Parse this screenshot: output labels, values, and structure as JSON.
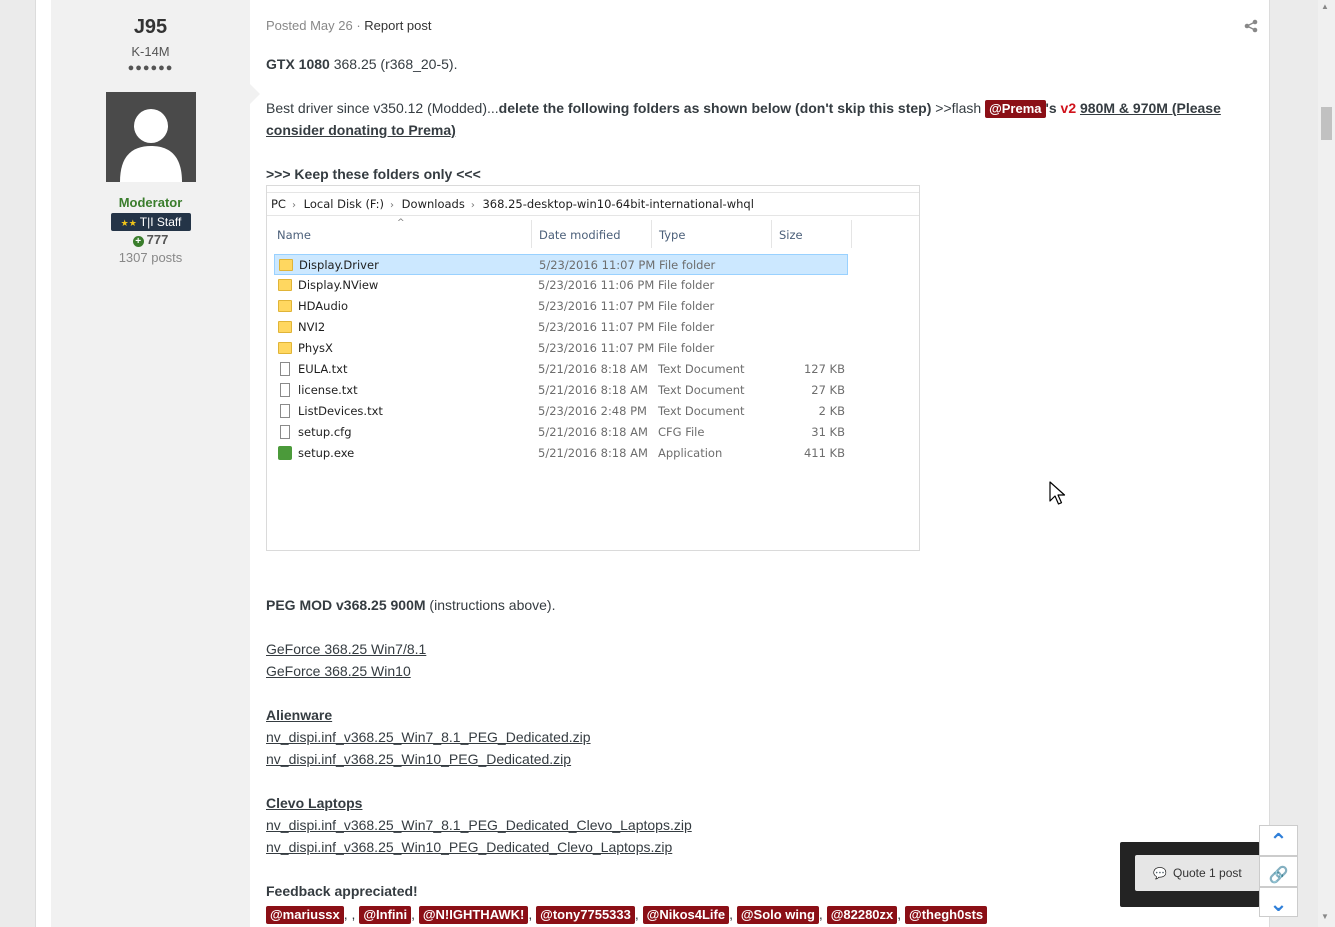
{
  "author": {
    "name": "J95",
    "title": "K-14M",
    "pips": "●●●●●●",
    "group": "Moderator",
    "badge": "T|I Staff",
    "badge_stars": "★★",
    "reputation": "777",
    "post_count": "1307 posts"
  },
  "post": {
    "posted": "Posted May 26",
    "separator": " · ",
    "report": "Report post",
    "line1_bold": "GTX 1080",
    "line1_rest": " 368.25 (r368_20-5).",
    "line2_start": "Best driver since v350.12 (Modded)...",
    "line2_bold": "delete the following folders as shown below (don't skip this step)",
    "line2_flash": "  >>flash ",
    "mention_prema": "@Prema",
    "apostrophe_s": "'s",
    "v2": "v2",
    "link_980": "980M & 970M (Please consider donating to Prema)",
    "keep_folders": ">>> Keep these folders only <<<",
    "peg_bold": "PEG MOD v368.25 900M",
    "peg_rest": " (instructions above).",
    "link_win7": "GeForce 368.25 Win7/8.1",
    "link_win10": "GeForce 368.25 Win10",
    "alienware": "Alienware",
    "alien_link1": "nv_dispi.inf_v368.25_Win7_8.1_PEG_Dedicated.zip",
    "alien_link2": "nv_dispi.inf_v368.25_Win10_PEG_Dedicated.zip",
    "clevo": "Clevo Laptops",
    "clevo_link1": "nv_dispi.inf_v368.25_Win7_8.1_PEG_Dedicated_Clevo_Laptops.zip",
    "clevo_link2": "nv_dispi.inf_v368.25_Win10_PEG_Dedicated_Clevo_Laptops.zip",
    "feedback": "Feedback appreciated!",
    "mentions": [
      "@mariussx",
      "@Infini",
      "@N!IGHTHAWK!",
      "@tony7755333",
      "@Nikos4Life",
      "@Solo wing",
      "@82280zx",
      "@thegh0sts"
    ]
  },
  "explorer": {
    "breadcrumb": [
      "PC",
      "Local Disk (F:)",
      "Downloads",
      "368.25-desktop-win10-64bit-international-whql"
    ],
    "columns": [
      "Name",
      "Date modified",
      "Type",
      "Size"
    ],
    "rows": [
      {
        "name": "Display.Driver",
        "date": "5/23/2016 11:07 PM",
        "type": "File folder",
        "size": "",
        "icon": "folder-icon",
        "selected": true
      },
      {
        "name": "Display.NView",
        "date": "5/23/2016 11:06 PM",
        "type": "File folder",
        "size": "",
        "icon": "folder-icon"
      },
      {
        "name": "HDAudio",
        "date": "5/23/2016 11:07 PM",
        "type": "File folder",
        "size": "",
        "icon": "folder-icon"
      },
      {
        "name": "NVI2",
        "date": "5/23/2016 11:07 PM",
        "type": "File folder",
        "size": "",
        "icon": "folder-icon"
      },
      {
        "name": "PhysX",
        "date": "5/23/2016 11:07 PM",
        "type": "File folder",
        "size": "",
        "icon": "folder-icon"
      },
      {
        "name": "EULA.txt",
        "date": "5/21/2016 8:18 AM",
        "type": "Text Document",
        "size": "127 KB",
        "icon": "text-file-icon"
      },
      {
        "name": "license.txt",
        "date": "5/21/2016 8:18 AM",
        "type": "Text Document",
        "size": "27 KB",
        "icon": "text-file-icon"
      },
      {
        "name": "ListDevices.txt",
        "date": "5/23/2016 2:48 PM",
        "type": "Text Document",
        "size": "2 KB",
        "icon": "text-file-icon"
      },
      {
        "name": "setup.cfg",
        "date": "5/21/2016 8:18 AM",
        "type": "CFG File",
        "size": "31 KB",
        "icon": "file-icon"
      },
      {
        "name": "setup.exe",
        "date": "5/21/2016 8:18 AM",
        "type": "Application",
        "size": "411 KB",
        "icon": "exe-icon"
      }
    ]
  },
  "quote_popup": {
    "label": "Quote 1 post"
  },
  "colors": {
    "mention_bg": "#8b0f16",
    "moderator_green": "#3a7d2c",
    "staff_badge": "#243447",
    "nav_blue": "#2f7fd9"
  }
}
